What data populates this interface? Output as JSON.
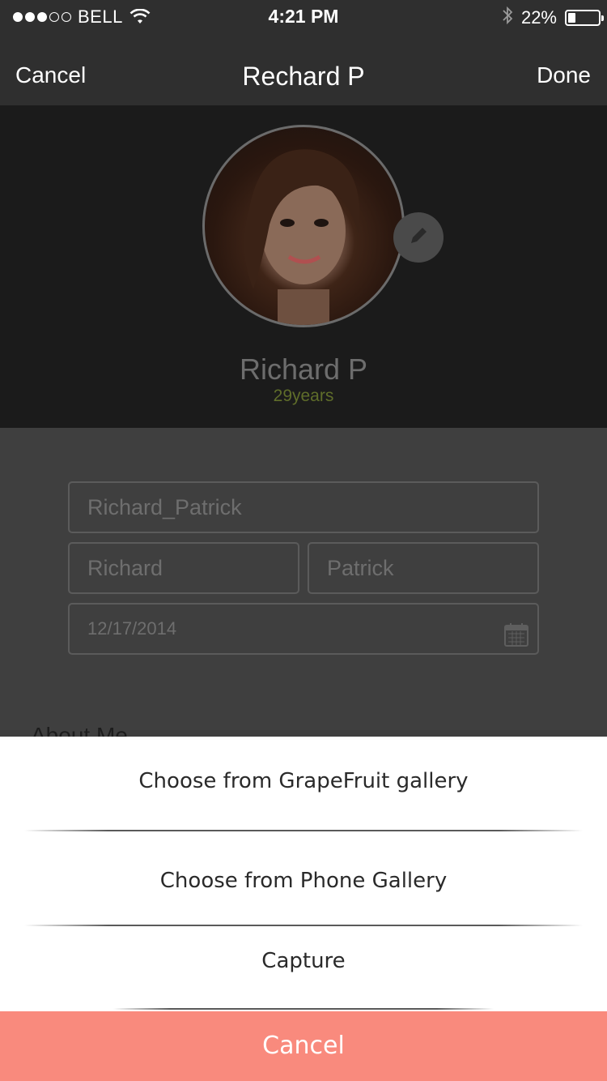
{
  "status_bar": {
    "carrier": "BELL",
    "time": "4:21 PM",
    "battery_percent": "22%",
    "battery_level": 0.22,
    "signal_bars_filled": 3,
    "signal_bars_total": 5
  },
  "nav": {
    "cancel_label": "Cancel",
    "title": "Rechard P",
    "done_label": "Done"
  },
  "profile": {
    "name": "Richard P",
    "age": "29years",
    "edit_icon": "pencil-icon"
  },
  "form": {
    "username": "Richard_Patrick",
    "first_name": "Richard",
    "last_name": "Patrick",
    "birth_date": "12/17/2014",
    "about_label": "About Me"
  },
  "action_sheet": {
    "options": [
      "Choose from GrapeFruit gallery",
      "Choose from Phone Gallery",
      "Capture"
    ],
    "cancel_label": "Cancel",
    "cancel_color": "#f98a7d"
  }
}
